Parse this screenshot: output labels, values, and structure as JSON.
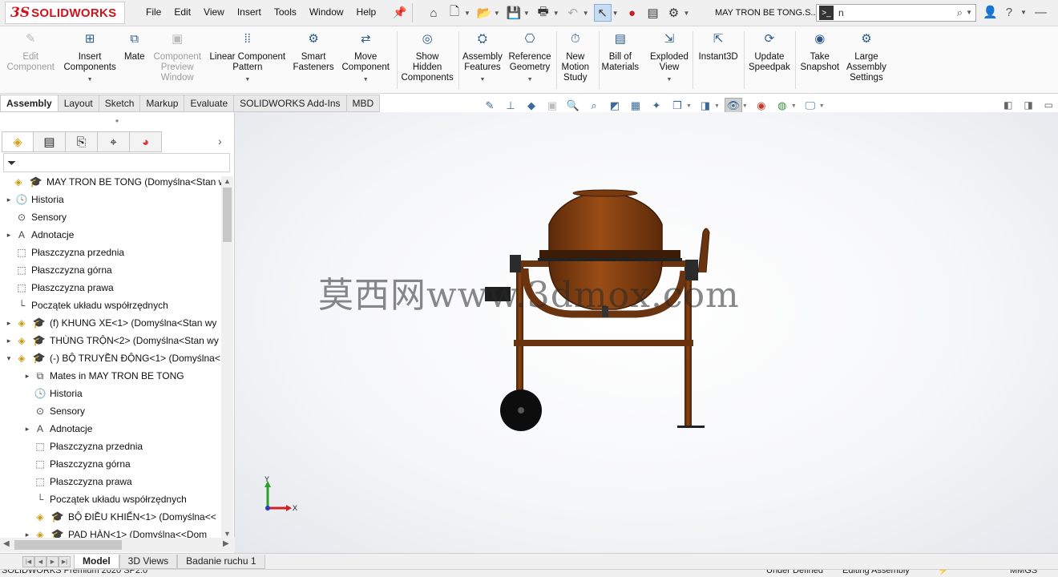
{
  "app": {
    "logo_ds": "3S",
    "logo_text": "SOLIDWORKS"
  },
  "menus": [
    "File",
    "Edit",
    "View",
    "Insert",
    "Tools",
    "Window",
    "Help"
  ],
  "document_title": "MAY TRON BE TONG.S...",
  "search": {
    "value": "n"
  },
  "command_manager": {
    "tools": [
      {
        "label": "Edit\nComponent",
        "icon": "edit-component-icon",
        "disabled": true
      },
      {
        "label": "Insert\nComponents",
        "icon": "insert-components-icon",
        "disabled": false,
        "caret": true
      },
      {
        "label": "Mate",
        "icon": "mate-icon",
        "disabled": false
      },
      {
        "label": "Component\nPreview\nWindow",
        "icon": "preview-window-icon",
        "disabled": true
      },
      {
        "label": "Linear Component\nPattern",
        "icon": "linear-pattern-icon",
        "disabled": false,
        "caret": true
      },
      {
        "label": "Smart\nFasteners",
        "icon": "smart-fasteners-icon",
        "disabled": false
      },
      {
        "label": "Move\nComponent",
        "icon": "move-component-icon",
        "disabled": false,
        "caret": true
      },
      {
        "label": "Show\nHidden\nComponents",
        "icon": "show-hidden-icon",
        "disabled": false
      },
      {
        "label": "Assembly\nFeatures",
        "icon": "assembly-features-icon",
        "disabled": false,
        "caret": true
      },
      {
        "label": "Reference\nGeometry",
        "icon": "reference-geometry-icon",
        "disabled": false,
        "caret": true
      },
      {
        "label": "New\nMotion\nStudy",
        "icon": "motion-study-icon",
        "disabled": false
      },
      {
        "label": "Bill of\nMaterials",
        "icon": "bom-icon",
        "disabled": false
      },
      {
        "label": "Exploded\nView",
        "icon": "exploded-view-icon",
        "disabled": false,
        "caret": true
      },
      {
        "label": "Instant3D",
        "icon": "instant3d-icon",
        "disabled": false
      },
      {
        "label": "Update\nSpeedpak",
        "icon": "speedpak-icon",
        "disabled": false
      },
      {
        "label": "Take\nSnapshot",
        "icon": "snapshot-icon",
        "disabled": false
      },
      {
        "label": "Large\nAssembly\nSettings",
        "icon": "large-assembly-icon",
        "disabled": false
      }
    ]
  },
  "tabs": [
    "Assembly",
    "Layout",
    "Sketch",
    "Markup",
    "Evaluate",
    "SOLIDWORKS Add-Ins",
    "MBD"
  ],
  "active_tab": "Assembly",
  "tree": [
    {
      "label": "MAY TRON BE TONG  (Domyślna<Stan wy",
      "depth": 0,
      "expander": "",
      "icon": "assembly-root-icon"
    },
    {
      "label": "Historia",
      "depth": 1,
      "expander": "▸",
      "icon": "history-icon"
    },
    {
      "label": "Sensory",
      "depth": 1,
      "expander": "",
      "icon": "sensor-icon"
    },
    {
      "label": "Adnotacje",
      "depth": 1,
      "expander": "▸",
      "icon": "annotations-icon"
    },
    {
      "label": "Płaszczyzna przednia",
      "depth": 1,
      "expander": "",
      "icon": "plane-icon"
    },
    {
      "label": "Płaszczyzna górna",
      "depth": 1,
      "expander": "",
      "icon": "plane-icon"
    },
    {
      "label": "Płaszczyzna prawa",
      "depth": 1,
      "expander": "",
      "icon": "plane-icon"
    },
    {
      "label": "Początek układu współrzędnych",
      "depth": 1,
      "expander": "",
      "icon": "origin-icon"
    },
    {
      "label": "(f) KHUNG XE<1> (Domyślna<Stan wy",
      "depth": 1,
      "expander": "▸",
      "icon": "subassembly-icon"
    },
    {
      "label": "THÙNG TRỘN<2> (Domyślna<Stan wy",
      "depth": 1,
      "expander": "▸",
      "icon": "subassembly-icon"
    },
    {
      "label": "(-) BỘ TRUYỀN ĐỘNG<1> (Domyślna<",
      "depth": 1,
      "expander": "▾",
      "icon": "subassembly-icon"
    },
    {
      "label": "Mates in MAY TRON BE TONG",
      "depth": 2,
      "expander": "▸",
      "icon": "mates-icon"
    },
    {
      "label": "Historia",
      "depth": 2,
      "expander": "",
      "icon": "history-icon"
    },
    {
      "label": "Sensory",
      "depth": 2,
      "expander": "",
      "icon": "sensor-icon"
    },
    {
      "label": "Adnotacje",
      "depth": 2,
      "expander": "▸",
      "icon": "annotations-icon"
    },
    {
      "label": "Płaszczyzna przednia",
      "depth": 2,
      "expander": "",
      "icon": "plane-icon"
    },
    {
      "label": "Płaszczyzna górna",
      "depth": 2,
      "expander": "",
      "icon": "plane-icon"
    },
    {
      "label": "Płaszczyzna prawa",
      "depth": 2,
      "expander": "",
      "icon": "plane-icon"
    },
    {
      "label": "Początek układu współrzędnych",
      "depth": 2,
      "expander": "",
      "icon": "origin-icon"
    },
    {
      "label": "BỘ ĐIỀU KHIỂN<1> (Domyślna<<",
      "depth": 2,
      "expander": "",
      "icon": "subassembly-icon"
    },
    {
      "label": "PAD HÀN<1> (Domyślna<<Dom",
      "depth": 2,
      "expander": "▸",
      "icon": "subassembly-icon"
    }
  ],
  "watermark": "莫西网www.3dmox.com",
  "triad": {
    "x": "X",
    "y": "Y"
  },
  "bottom_tabs": [
    "Model",
    "3D Views",
    "Badanie ruchu 1"
  ],
  "active_bottom_tab": "Model",
  "status": {
    "product": "SOLIDWORKS Premium 2020 SP2.0",
    "definition": "Under Defined",
    "mode": "Editing Assembly",
    "units": "MMGS"
  },
  "colors": {
    "mixer_drum": "#8b4513",
    "frame": "#7a3d12",
    "accent": "#d0121a"
  }
}
